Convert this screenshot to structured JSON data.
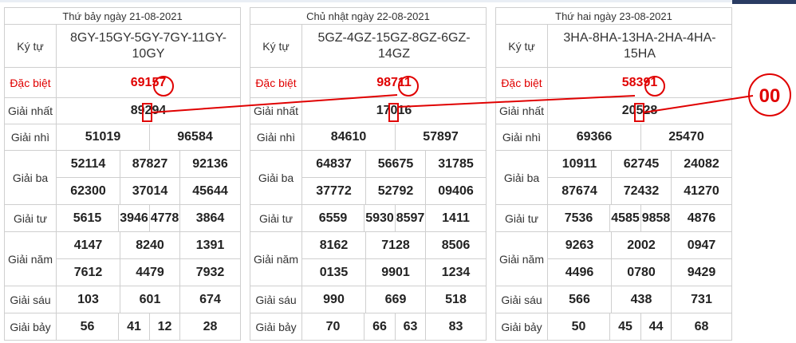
{
  "labels": {
    "symbol": "Ký tự",
    "special": "Đặc biệt",
    "first": "Giải nhất",
    "second": "Giải nhì",
    "third": "Giải ba",
    "fourth": "Giải tư",
    "fifth": "Giải năm",
    "sixth": "Giải sáu",
    "seventh": "Giải bảy"
  },
  "tables": [
    {
      "date": "Thứ bảy ngày 21-08-2021",
      "symbol": "8GY-15GY-5GY-7GY-11GY-10GY",
      "special": "69157",
      "first": "89294",
      "second": [
        "51019",
        "96584"
      ],
      "third": [
        "52114",
        "87827",
        "92136",
        "62300",
        "37014",
        "45644"
      ],
      "fourth": [
        "5615",
        "3946",
        "4778",
        "3864"
      ],
      "fifth": [
        "4147",
        "8240",
        "1391",
        "7612",
        "4479",
        "7932"
      ],
      "sixth": [
        "103",
        "601",
        "674"
      ],
      "seventh": [
        "56",
        "41",
        "12",
        "28"
      ]
    },
    {
      "date": "Chủ nhật ngày 22-08-2021",
      "symbol": "5GZ-4GZ-15GZ-8GZ-6GZ-14GZ",
      "special": "98711",
      "first": "17016",
      "second": [
        "84610",
        "57897"
      ],
      "third": [
        "64837",
        "56675",
        "31785",
        "37772",
        "52792",
        "09406"
      ],
      "fourth": [
        "6559",
        "5930",
        "8597",
        "1411"
      ],
      "fifth": [
        "8162",
        "7128",
        "8506",
        "0135",
        "9901",
        "1234"
      ],
      "sixth": [
        "990",
        "669",
        "518"
      ],
      "seventh": [
        "70",
        "66",
        "63",
        "83"
      ]
    },
    {
      "date": "Thứ hai ngày 23-08-2021",
      "symbol": "3HA-8HA-13HA-2HA-4HA-15HA",
      "special": "58391",
      "first": "20528",
      "second": [
        "69366",
        "25470"
      ],
      "third": [
        "10911",
        "62745",
        "24082",
        "87674",
        "72432",
        "41270"
      ],
      "fourth": [
        "7536",
        "4585",
        "9858",
        "4876"
      ],
      "fifth": [
        "9263",
        "2002",
        "0947",
        "4496",
        "0780",
        "9429"
      ],
      "sixth": [
        "566",
        "438",
        "731"
      ],
      "seventh": [
        "50",
        "45",
        "44",
        "68"
      ]
    }
  ],
  "annotation": {
    "label": "00",
    "color": "#e00000"
  }
}
